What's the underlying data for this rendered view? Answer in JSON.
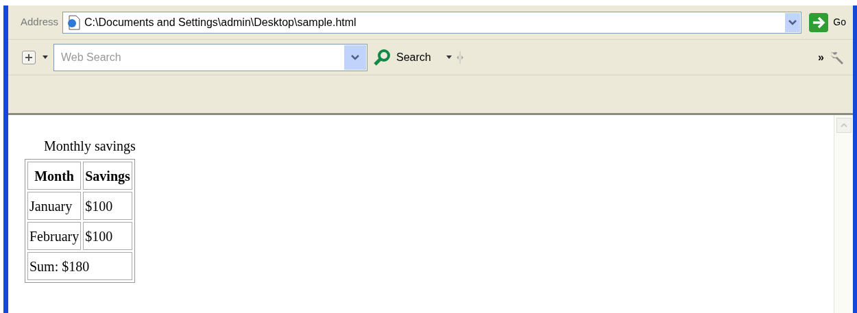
{
  "address_bar": {
    "label": "Address",
    "url": "C:\\Documents and Settings\\admin\\Desktop\\sample.html",
    "go_button": "Go"
  },
  "search_toolbar": {
    "placeholder": "Web Search",
    "search_button": "Search",
    "overflow": "»"
  },
  "page": {
    "caption": "Monthly savings",
    "columns": [
      "Month",
      "Savings"
    ],
    "rows": [
      [
        "January",
        "$100"
      ],
      [
        "February",
        "$100"
      ]
    ],
    "footer": "Sum: $180"
  }
}
